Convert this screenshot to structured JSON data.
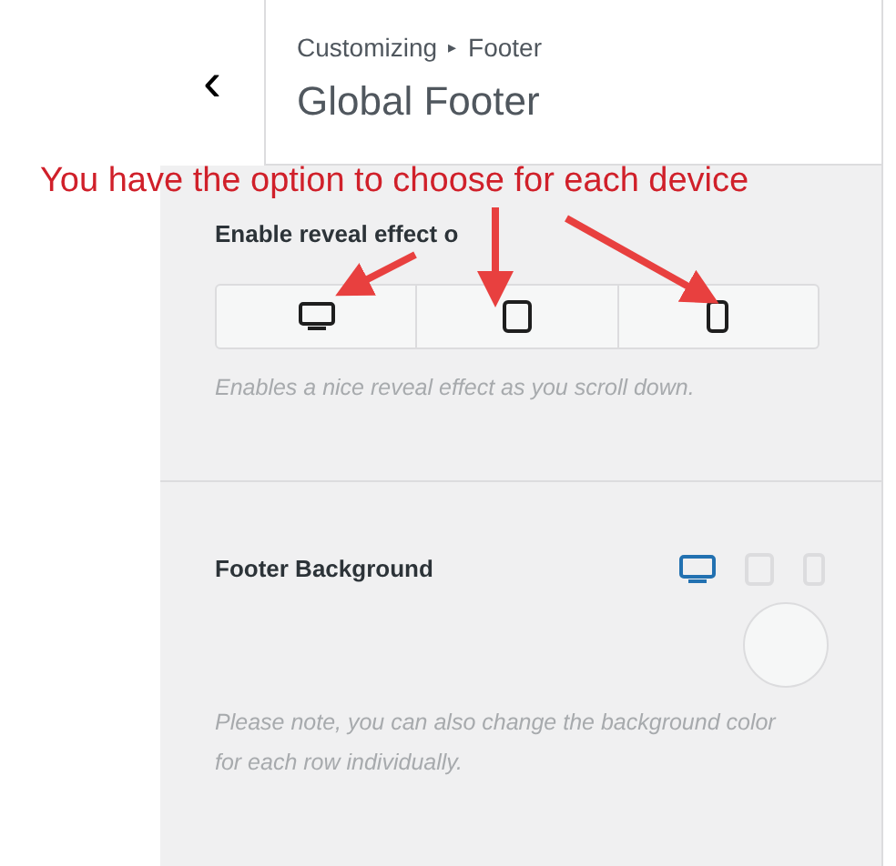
{
  "header": {
    "back": "‹",
    "breadcrumb": [
      "Customizing",
      "Footer"
    ],
    "separator": "▸",
    "title": "Global Footer"
  },
  "annotation": {
    "text": "You have the option to choose for each device"
  },
  "reveal": {
    "label": "Enable reveal effect o",
    "devices": [
      {
        "kind": "desktop"
      },
      {
        "kind": "tablet"
      },
      {
        "kind": "mobile"
      }
    ],
    "description": "Enables a nice reveal effect as you scroll down."
  },
  "footer_background": {
    "label": "Footer Background",
    "devices": [
      {
        "kind": "desktop",
        "selected": true
      },
      {
        "kind": "tablet",
        "selected": false
      },
      {
        "kind": "mobile",
        "selected": false
      }
    ],
    "note": "Please note, you can also change the background color for each row individually."
  }
}
